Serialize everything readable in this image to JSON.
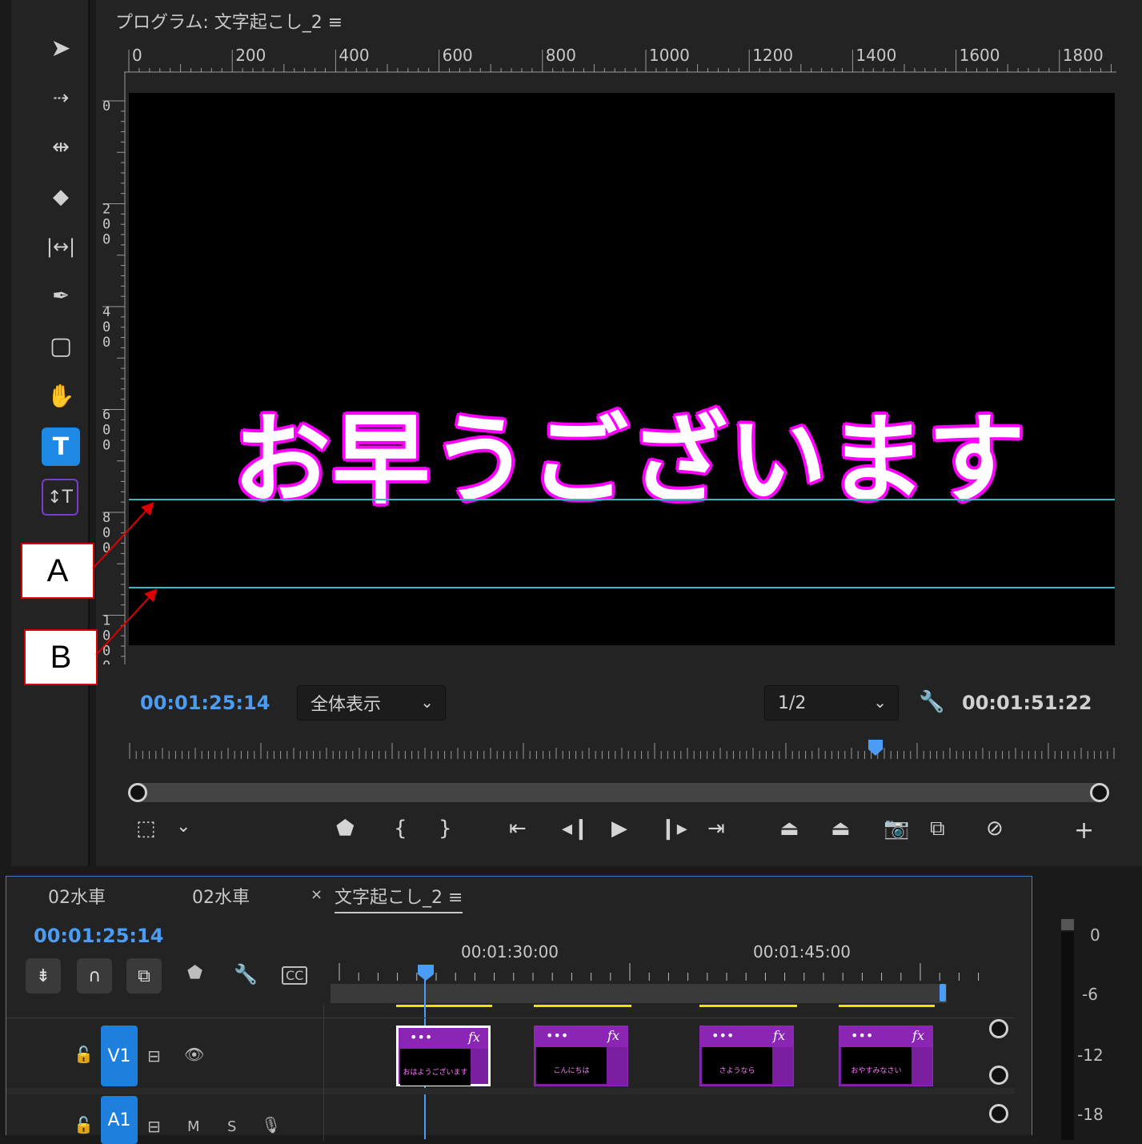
{
  "monitor": {
    "title": "プログラム: 文字起こし_2 ≡",
    "hruler_labels": [
      "0",
      "200",
      "400",
      "600",
      "800",
      "1000",
      "1200",
      "1400",
      "1600",
      "1800"
    ],
    "vruler_labels": [
      "0",
      "2\n0\n0",
      "4\n0\n0",
      "6\n0\n0",
      "8\n0\n0",
      "1\n0\n0\n0"
    ],
    "caption": "お早うございます",
    "current_timecode": "00:01:25:14",
    "fit_select": "全体表示",
    "resolution_select": "1/2",
    "duration_timecode": "00:01:51:22",
    "accent_blue": "#4a9cf5",
    "caption_outline": "#ff00ff",
    "guide_color": "#2fbcc4"
  },
  "tools": [
    "selection-tool",
    "track-select-tool",
    "ripple-edit-tool",
    "razor-tool",
    "slip-tool",
    "pen-tool",
    "rectangle-tool",
    "hand-tool",
    "type-tool",
    "vertical-type-tool"
  ],
  "annotations": {
    "a": "A",
    "b": "B"
  },
  "timeline": {
    "tabs": [
      "02水車",
      "02水車",
      "文字起こし_2 ≡"
    ],
    "close_glyph": "×",
    "current_timecode": "00:01:25:14",
    "ruler_marks": [
      "00:01:30:00",
      "00:01:45:00"
    ],
    "tracks": {
      "v1": "V1",
      "a1": "A1",
      "m": "M",
      "s": "S"
    },
    "clips": [
      {
        "thumb_text": "おはようございます",
        "selected": true
      },
      {
        "thumb_text": "こんにちは",
        "selected": false
      },
      {
        "thumb_text": "さようなら",
        "selected": false
      },
      {
        "thumb_text": "おやすみなさい",
        "selected": false
      }
    ],
    "clip_dots": "•••",
    "clip_fx": "fx"
  },
  "meter": {
    "labels": [
      "0",
      "-6",
      "-12",
      "-18"
    ]
  }
}
